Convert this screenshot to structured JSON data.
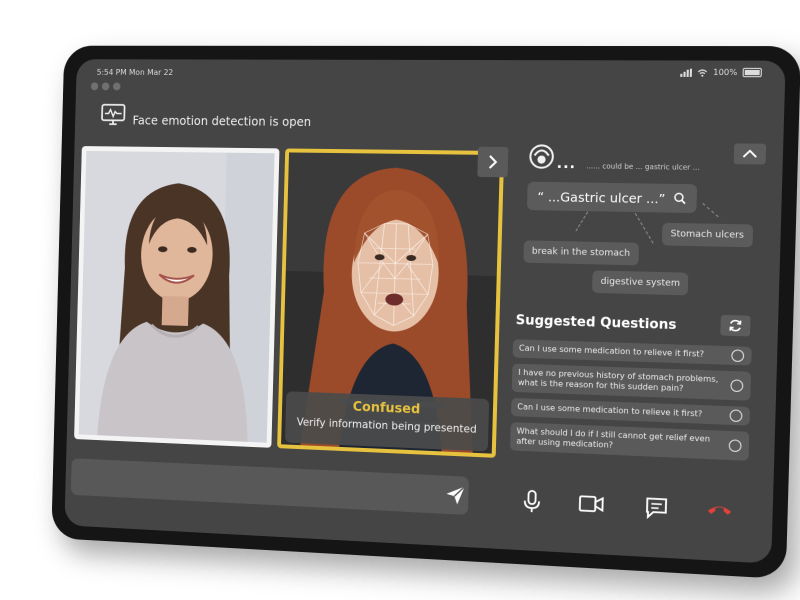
{
  "status_bar": {
    "time": "5:54 PM  Mon Mar 22",
    "battery": "100%"
  },
  "header": {
    "title": "Face emotion detection is open",
    "icon": "monitor-pulse-icon"
  },
  "video": {
    "emotion_label": "Confused",
    "emotion_message": "Verify information being presented",
    "highlight_color": "#e6c23f"
  },
  "transcript": {
    "ellipsis": "...",
    "text": "...... could be ... gastric ulcer ...",
    "keyword": "“ ...Gastric ulcer ...”",
    "related_terms": [
      "Stomach ulcers",
      "break in the stomach",
      "digestive system"
    ]
  },
  "suggested": {
    "title": "Suggested Questions",
    "questions": [
      "Can I use some medication to relieve it first?",
      "I have no previous history of stomach problems, what is the reason for this sudden pain?",
      "Can I use some medication to relieve it first?",
      "What should I do if I still cannot get relief even after using medication?"
    ]
  },
  "message_input": {
    "value": ""
  },
  "colors": {
    "screen": "#454545",
    "end_call": "#e0413a",
    "accent": "#e6c23f"
  }
}
